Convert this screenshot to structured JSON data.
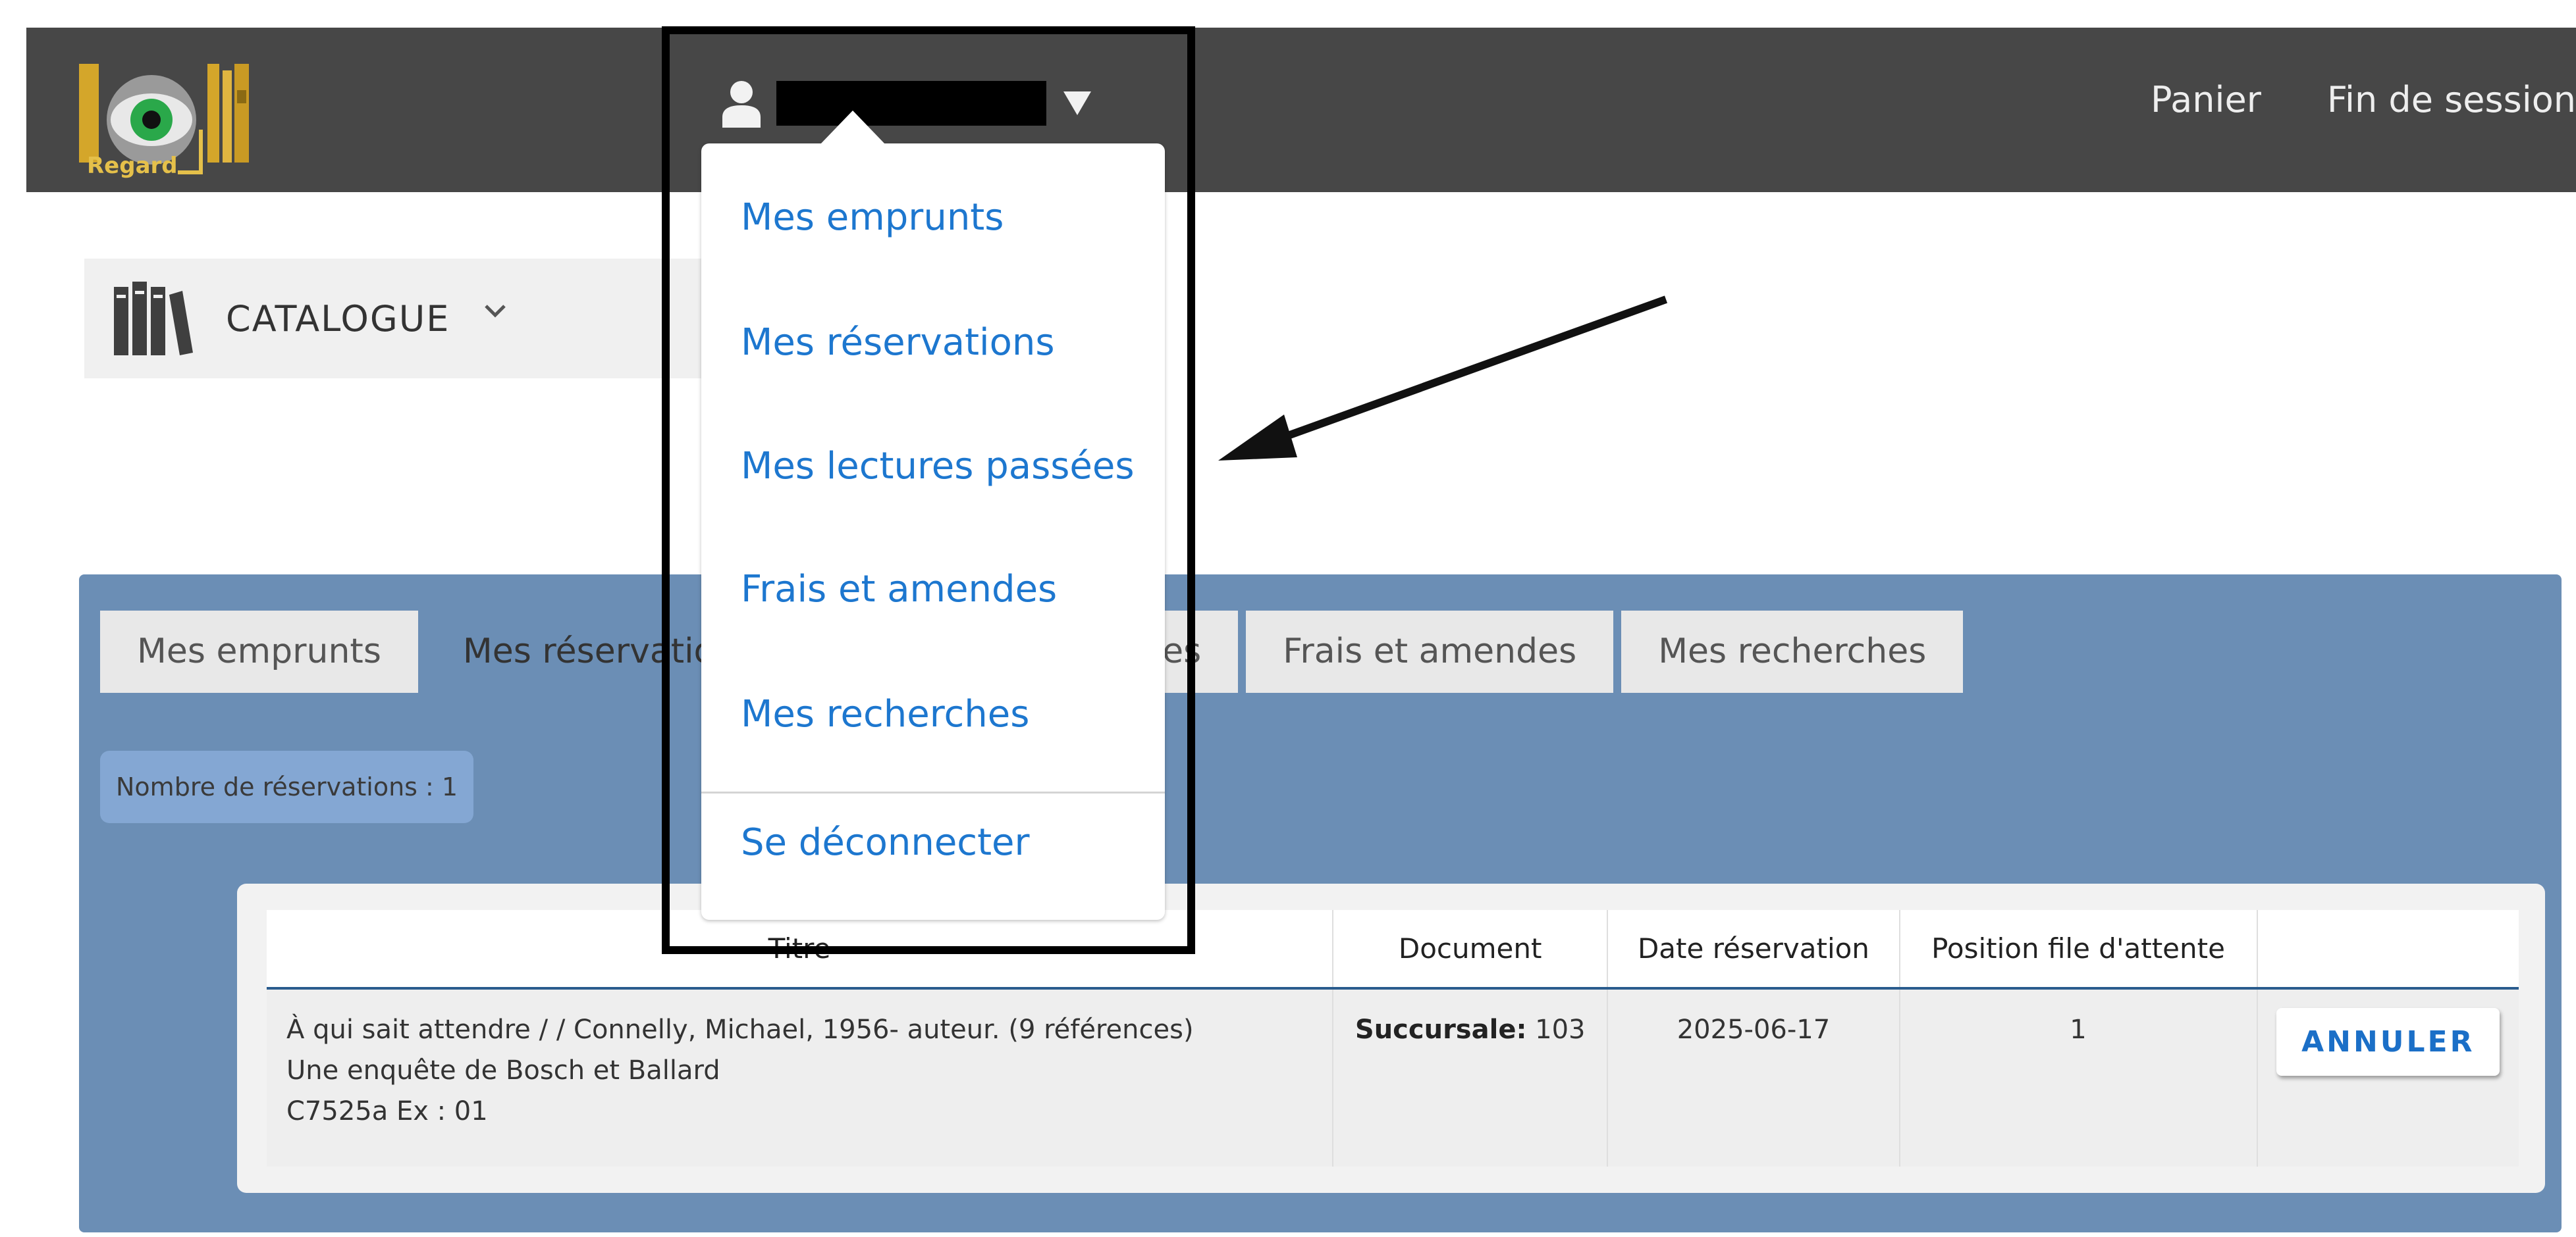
{
  "header": {
    "logo_text": "Regard",
    "links": [
      "Panier",
      "Fin de session"
    ]
  },
  "catalogue": {
    "label": "CATALOGUE",
    "icon": "books-icon"
  },
  "user_menu": {
    "items": [
      "Mes emprunts",
      "Mes réservations",
      "Mes lectures passées",
      "Frais et amendes",
      "Mes recherches"
    ],
    "logout": "Se déconnecter"
  },
  "tabs": [
    "Mes emprunts",
    "Mes réservations",
    "Mes lectures passées",
    "Frais et amendes",
    "Mes recherches"
  ],
  "reservations_badge": "Nombre de réservations : 1",
  "table": {
    "headers": [
      "Titre",
      "Document",
      "Date réservation",
      "Position file d'attente",
      ""
    ],
    "rows": [
      {
        "title_line1": "À qui sait attendre / / Connelly, Michael, 1956- auteur. (9 références)",
        "title_line2": "Une enquête de Bosch et Ballard",
        "title_line3": "C7525a Ex : 01",
        "document_label": "Succursale:",
        "document_value": " 103",
        "date": "2025-06-17",
        "position": "1",
        "action": "ANNULER"
      }
    ]
  },
  "colors": {
    "header_bg": "#474747",
    "panel_bg": "#6b8eb5",
    "link": "#1d77cf"
  }
}
